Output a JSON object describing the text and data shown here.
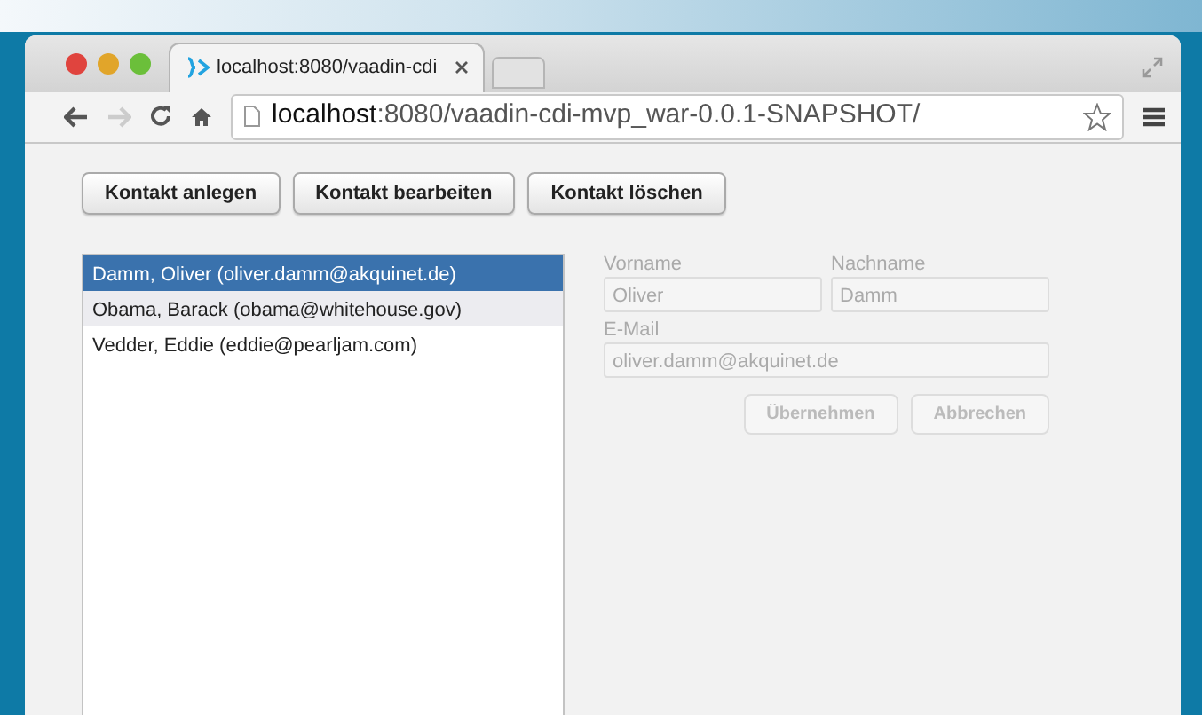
{
  "browser": {
    "tab": {
      "title": "localhost:8080/vaadin-cdi",
      "selected": true
    },
    "url_host": "localhost",
    "url_rest": ":8080/vaadin-cdi-mvp_war-0.0.1-SNAPSHOT/"
  },
  "actions": [
    "Kontakt anlegen",
    "Kontakt bearbeiten",
    "Kontakt löschen"
  ],
  "contacts": [
    {
      "label": "Damm, Oliver (oliver.damm@akquinet.de)",
      "selected": true,
      "highlighted": false
    },
    {
      "label": "Obama, Barack (obama@whitehouse.gov)",
      "selected": false,
      "highlighted": true
    },
    {
      "label": "Vedder, Eddie (eddie@pearljam.com)",
      "selected": false,
      "highlighted": false
    }
  ],
  "form": {
    "fields": [
      {
        "label": "Vorname",
        "value": "Oliver",
        "kind": "half",
        "disabled": true
      },
      {
        "label": "Nachname",
        "value": "Damm",
        "kind": "half",
        "disabled": true
      },
      {
        "label": "E-Mail",
        "value": "oliver.damm@akquinet.de",
        "kind": "wide",
        "disabled": true
      }
    ],
    "buttons": [
      {
        "label": "Übernehmen",
        "disabled": true
      },
      {
        "label": "Abbrechen",
        "disabled": true
      }
    ]
  }
}
